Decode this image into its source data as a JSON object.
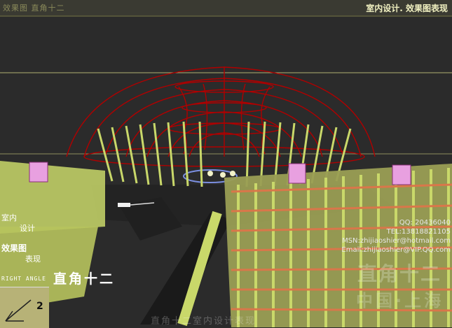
{
  "header": {
    "left_title": "效果图 直角十二",
    "right_title": "室内设计. 效果图表现"
  },
  "left_labels": {
    "line1": "室内",
    "line2": "设计",
    "line3": "效果图",
    "line4": "表现"
  },
  "contact": {
    "qq": "QQ: 20436040",
    "tel": "TEL:13818821105",
    "msn": "MSN:zhijiaoshier@hotmail.com",
    "email": "Email:zhijiaoshier@VIP.QQ.com"
  },
  "brand": {
    "cn": "直角十二",
    "en": "RIGHT ANGLE"
  },
  "corner": {
    "number": "2"
  },
  "watermark": {
    "line1": "直角十二",
    "line2": "中国·上海"
  },
  "bottom_caption": "直角十二室内设计表现",
  "colors": {
    "dome": "#b00000",
    "poles": "#c9d86a",
    "bars": "#d9774a",
    "lamps": "#e8a0e0"
  }
}
